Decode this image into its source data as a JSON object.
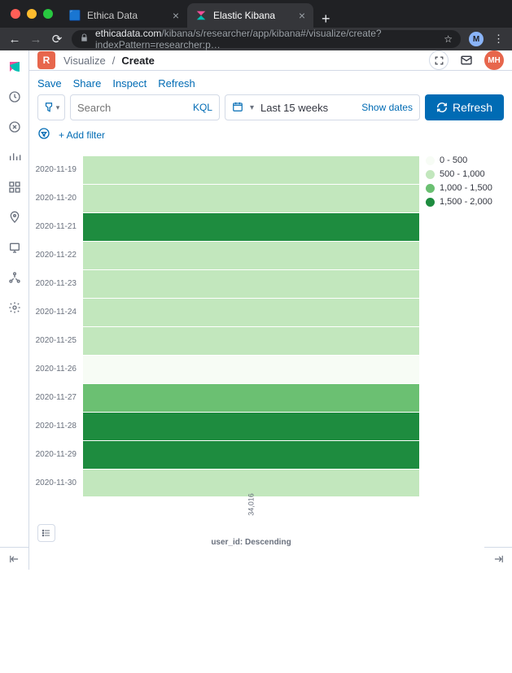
{
  "browser": {
    "tabs": [
      {
        "label": "Ethica Data",
        "active": false
      },
      {
        "label": "Elastic Kibana",
        "active": true
      }
    ],
    "url_host": "ethicadata.com",
    "url_path": "/kibana/s/researcher/app/kibana#/visualize/create?indexPattern=researcher:p…",
    "avatar": "M"
  },
  "header": {
    "badge": "R",
    "crumb_app": "Visualize",
    "crumb_current": "Create",
    "avatar": "MH"
  },
  "actions": {
    "save": "Save",
    "share": "Share",
    "inspect": "Inspect",
    "reload": "Refresh"
  },
  "query": {
    "placeholder": "Search",
    "lang": "KQL",
    "time": "Last 15 weeks",
    "show_dates": "Show dates",
    "refresh": "Refresh"
  },
  "filter": {
    "add": "+ Add filter"
  },
  "legend": {
    "items": [
      {
        "label": "0 - 500",
        "color": "#f7fcf5"
      },
      {
        "label": "500 - 1,000",
        "color": "#c2e7bd"
      },
      {
        "label": "1,000 - 1,500",
        "color": "#6bc072"
      },
      {
        "label": "1,500 - 2,000",
        "color": "#1e8c3f"
      }
    ]
  },
  "xaxis": {
    "tick": "34,016",
    "title": "user_id: Descending"
  },
  "chart_data": {
    "type": "heatmap",
    "xlabel": "user_id: Descending",
    "ylabel": "",
    "x": [
      "34016"
    ],
    "y": [
      "2020-11-19",
      "2020-11-20",
      "2020-11-21",
      "2020-11-22",
      "2020-11-23",
      "2020-11-24",
      "2020-11-25",
      "2020-11-26",
      "2020-11-27",
      "2020-11-28",
      "2020-11-29",
      "2020-11-30"
    ],
    "rows": [
      {
        "date": "2020-11-19",
        "bucket": "500 - 1,000",
        "value": 750,
        "color": "#c2e7bd"
      },
      {
        "date": "2020-11-20",
        "bucket": "500 - 1,000",
        "value": 750,
        "color": "#c2e7bd"
      },
      {
        "date": "2020-11-21",
        "bucket": "1,500 - 2,000",
        "value": 1750,
        "color": "#1e8c3f"
      },
      {
        "date": "2020-11-22",
        "bucket": "500 - 1,000",
        "value": 750,
        "color": "#c2e7bd"
      },
      {
        "date": "2020-11-23",
        "bucket": "500 - 1,000",
        "value": 750,
        "color": "#c2e7bd"
      },
      {
        "date": "2020-11-24",
        "bucket": "500 - 1,000",
        "value": 750,
        "color": "#c2e7bd"
      },
      {
        "date": "2020-11-25",
        "bucket": "500 - 1,000",
        "value": 750,
        "color": "#c2e7bd"
      },
      {
        "date": "2020-11-26",
        "bucket": "0 - 500",
        "value": 250,
        "color": "#f7fcf5"
      },
      {
        "date": "2020-11-27",
        "bucket": "1,000 - 1,500",
        "value": 1250,
        "color": "#6bc072"
      },
      {
        "date": "2020-11-28",
        "bucket": "1,500 - 2,000",
        "value": 1750,
        "color": "#1e8c3f"
      },
      {
        "date": "2020-11-29",
        "bucket": "1,500 - 2,000",
        "value": 1750,
        "color": "#1e8c3f"
      },
      {
        "date": "2020-11-30",
        "bucket": "500 - 1,000",
        "value": 750,
        "color": "#c2e7bd"
      }
    ],
    "legend_buckets": [
      "0 - 500",
      "500 - 1,000",
      "1,000 - 1,500",
      "1,500 - 2,000"
    ]
  }
}
